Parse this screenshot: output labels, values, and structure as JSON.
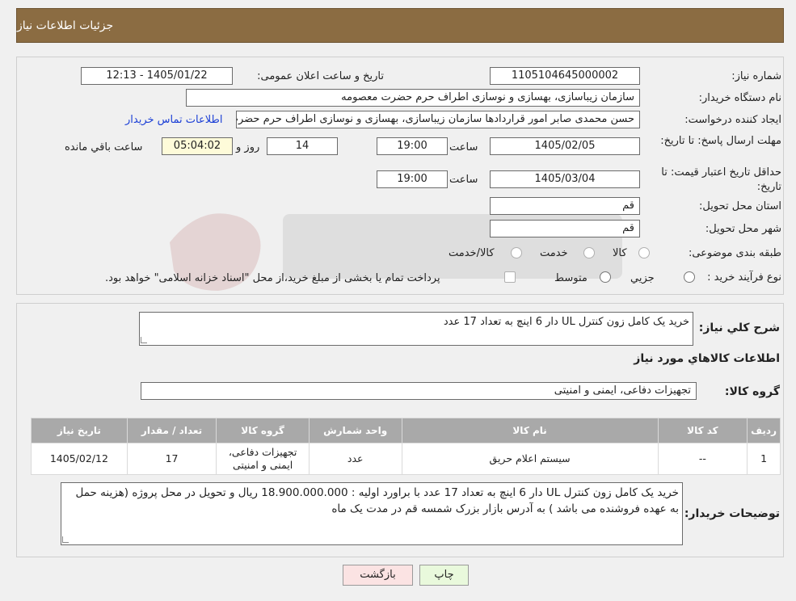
{
  "header": {
    "title": "جزئیات اطلاعات نیاز"
  },
  "form": {
    "need_number_label": "شماره نیاز:",
    "need_number": "1105104645000002",
    "announce_label": "تاریخ و ساعت اعلان عمومی:",
    "announce_value": "1405/01/22 - 12:13",
    "buyer_label": "نام دستگاه خریدار:",
    "buyer_value": "سازمان زیباسازی، بهسازی و نوسازی اطراف حرم حضرت معصومه",
    "creator_label": "ایجاد کننده درخواست:",
    "creator_value": "حسن محمدی صابر امور قراردادها سازمان زیباسازی، بهسازی و نوسازی اطراف حرم حضرت معصومه",
    "contact_link": "اطلاعات تماس خریدار",
    "deadline_label": "مهلت ارسال پاسخ: تا تاریخ:",
    "deadline_date": "1405/02/05",
    "time_label": "ساعت",
    "deadline_time": "19:00",
    "days_value": "14",
    "days_label": "روز و",
    "remaining_time": "05:04:02",
    "remaining_label": "ساعت باقي مانده",
    "validity_label": "حداقل تاریخ اعتبار قیمت: تا تاریخ:",
    "validity_date": "1405/03/04",
    "validity_time": "19:00",
    "province_label": "استان محل تحویل:",
    "province_value": "قم",
    "city_label": "شهر محل تحویل:",
    "city_value": "قم",
    "category_label": "طبقه بندی موضوعی:",
    "category_options": [
      "کالا",
      "خدمت",
      "کالا/خدمت"
    ],
    "process_label": "نوع فرآیند خرید :",
    "process_options": [
      "جزیي",
      "متوسط"
    ],
    "process_note": "پرداخت تمام یا بخشی از مبلغ خرید،از محل \"اسناد خزانه اسلامی\" خواهد بود."
  },
  "details": {
    "summary_label": "شرح کلي نیاز:",
    "summary_value": "خرید یک کامل زون کنترل UL دار 6 اینچ به تعداد 17 عدد",
    "goods_info_title": "اطلاعات کالاهاي مورد نیاز",
    "goods_group_label": "گروه کالا:",
    "goods_group_value": "تجهیزات دفاعی، ایمنی و امنیتی"
  },
  "table": {
    "headers": [
      "ردیف",
      "کد کالا",
      "نام کالا",
      "واحد شمارش",
      "گروه کالا",
      "تعداد / مقدار",
      "تاریخ نیاز"
    ],
    "rows": [
      [
        "1",
        "--",
        "سیستم اعلام حریق",
        "عدد",
        "تجهیزات دفاعی، ایمنی و امنیتی",
        "17",
        "1405/02/12"
      ]
    ]
  },
  "buyer_notes": {
    "label": "توضیحات خریدار:",
    "value": "خرید یک کامل زون کنترل UL دار 6 اینچ به تعداد 17 عدد با براورد اولیه : 18.900.000.000 ریال و تحویل در محل پروژه (هزینه حمل به عهده فروشنده می باشد ) به آدرس بازار بزرک شمسه قم  در مدت یک ماه"
  },
  "buttons": {
    "print": "چاپ",
    "back": "بازگشت"
  },
  "colors": {
    "header": "#8b6c42",
    "link": "#1b3fd6",
    "print_btn": "#e9f9dc",
    "back_btn": "#fbe3e3"
  }
}
